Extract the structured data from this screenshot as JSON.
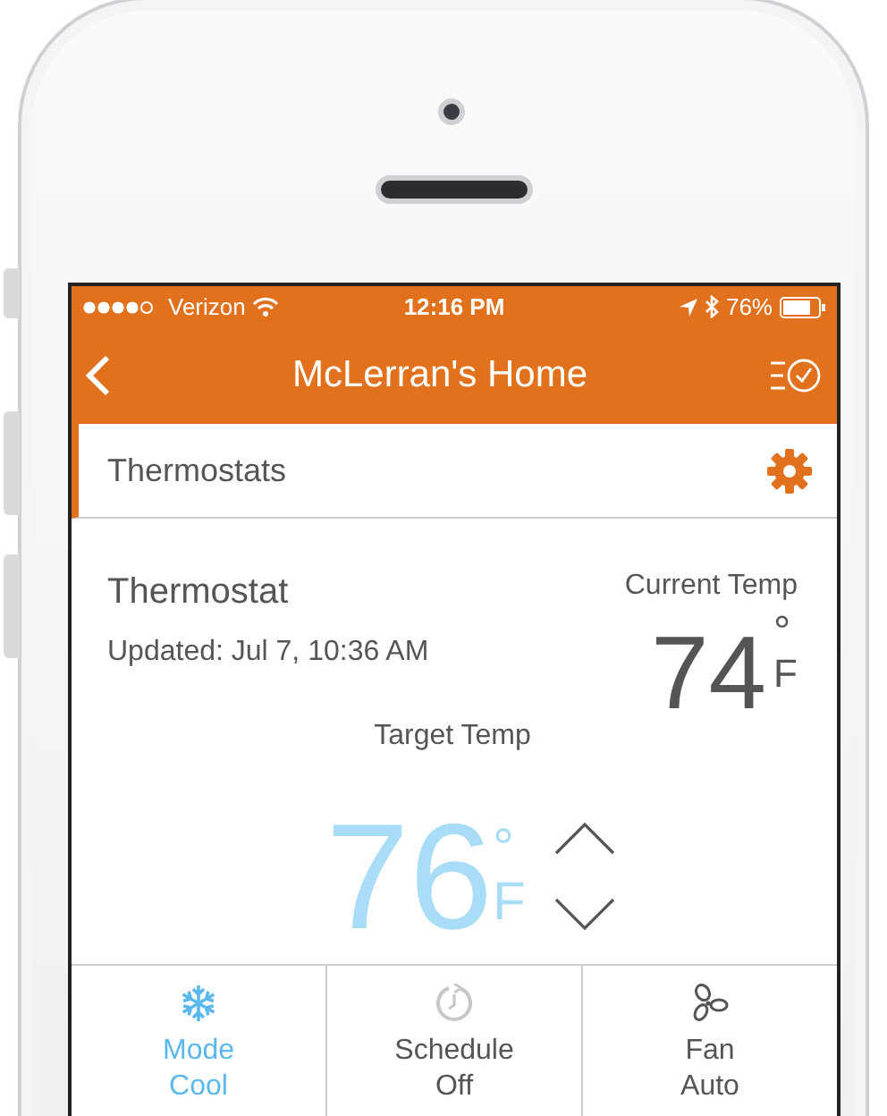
{
  "status_bar": {
    "carrier": "Verizon",
    "time": "12:16 PM",
    "battery": "76%"
  },
  "nav_bar": {
    "title": "McLerran's Home"
  },
  "section": {
    "title": "Thermostats"
  },
  "thermostat": {
    "name": "Thermostat",
    "updated": "Updated: Jul 7, 10:36 AM",
    "current_label": "Current Temp",
    "current_value": "74",
    "current_degree": "°",
    "current_unit": "F",
    "target_label": "Target Temp",
    "target_value": "76",
    "target_degree": "°",
    "target_unit": "F"
  },
  "controls": [
    {
      "kind": "snowflake",
      "label": "Mode",
      "value": "Cool",
      "selected": true
    },
    {
      "kind": "clock",
      "label": "Schedule",
      "value": "Off",
      "selected": false
    },
    {
      "kind": "fan",
      "label": "Fan",
      "value": "Auto",
      "selected": false
    }
  ]
}
